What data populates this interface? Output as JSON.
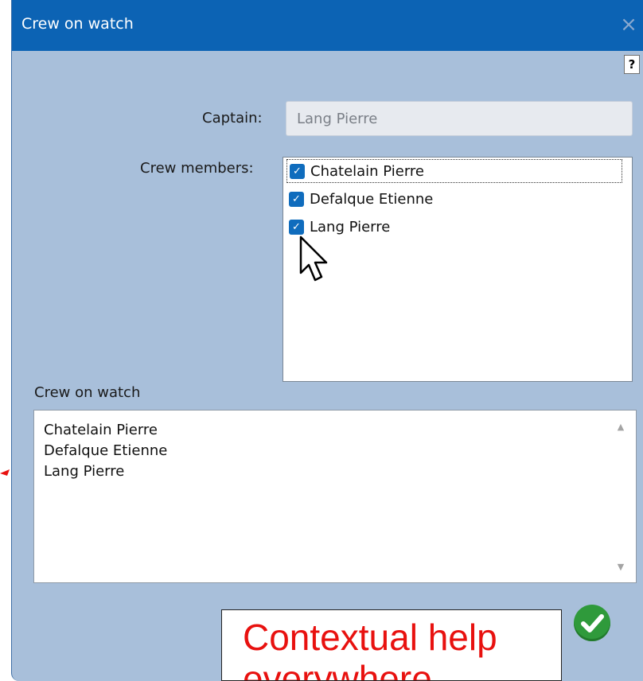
{
  "window": {
    "title": "Crew on watch",
    "close_glyph": "×",
    "help_glyph": "?"
  },
  "form": {
    "captain_label": "Captain:",
    "captain_value": "Lang Pierre",
    "crew_members_label": "Crew members:",
    "crew_members": [
      {
        "name": "Chatelain Pierre",
        "checked": true
      },
      {
        "name": "Defalque Etienne",
        "checked": true
      },
      {
        "name": "Lang Pierre",
        "checked": true
      }
    ],
    "crew_on_watch_label": "Crew on watch",
    "crew_on_watch_lines": [
      "Chatelain Pierre",
      "Defalque Etienne",
      "Lang Pierre"
    ]
  },
  "overlay": {
    "help_text": "Contextual help everywhere"
  },
  "icons": {
    "check": "✓",
    "scroll_up": "▲",
    "scroll_down": "▼",
    "ok": "check-circle-icon",
    "cursor": "mouse-pointer-icon",
    "help": "question-icon",
    "close": "close-icon"
  },
  "colors": {
    "titlebar": "#0c63b4",
    "dialog_bg": "#a8bfda",
    "checkbox": "#0f6cbd",
    "ok_button": "#2f9a3b",
    "help_text": "#e8110f"
  }
}
